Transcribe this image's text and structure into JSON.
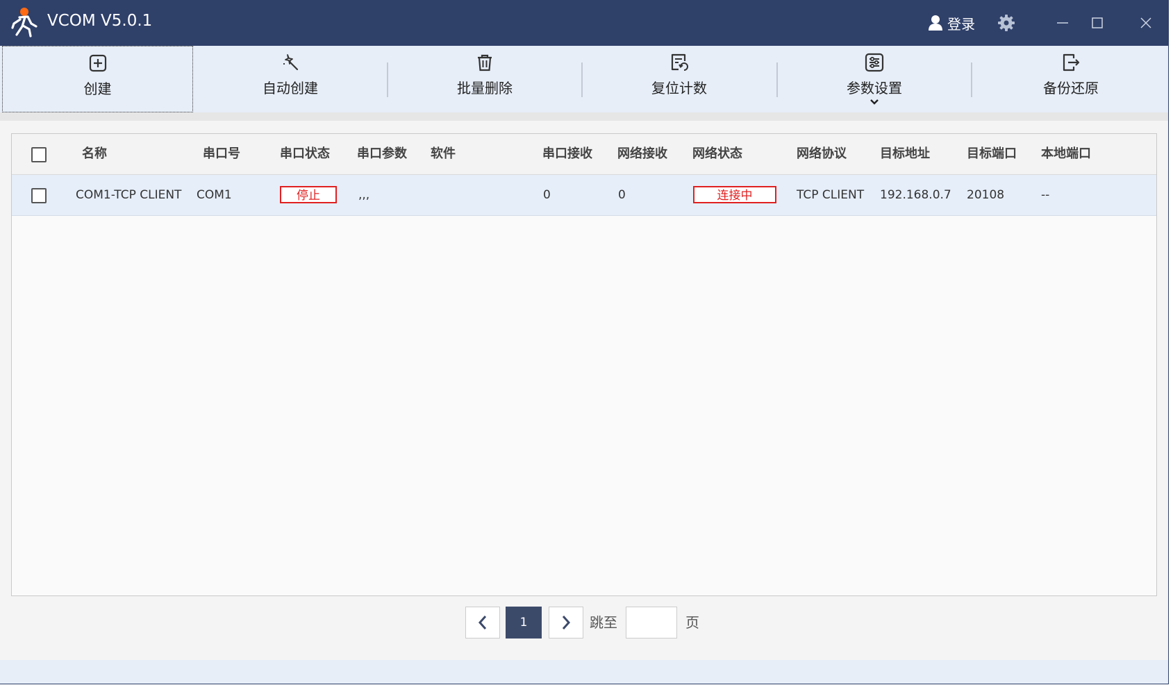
{
  "window": {
    "title": "VCOM V5.0.1"
  },
  "titlebar": {
    "login_label": "登录"
  },
  "toolbar": [
    {
      "label": "创建",
      "icon": "plus-square-icon"
    },
    {
      "label": "自动创建",
      "icon": "magic-wand-icon"
    },
    {
      "label": "批量删除",
      "icon": "trash-icon"
    },
    {
      "label": "复位计数",
      "icon": "reset-counter-icon"
    },
    {
      "label": "参数设置",
      "icon": "sliders-icon"
    },
    {
      "label": "备份还原",
      "icon": "backup-restore-icon"
    }
  ],
  "table": {
    "columns": [
      "名称",
      "串口号",
      "串口状态",
      "串口参数",
      "软件",
      "串口接收",
      "网络接收",
      "网络状态",
      "网络协议",
      "目标地址",
      "目标端口",
      "本地端口"
    ],
    "rows": [
      {
        "name": "COM1-TCP CLIENT",
        "port": "COM1",
        "port_status": "停止",
        "port_params": ",,,",
        "software": "",
        "port_rx": "0",
        "net_rx": "0",
        "net_status": "连接中",
        "protocol": "TCP CLIENT",
        "target_addr": "192.168.0.7",
        "target_port": "20108",
        "local_port": "--"
      }
    ]
  },
  "pagination": {
    "current_page": "1",
    "jump_to_label": "跳至",
    "page_suffix": "页",
    "jump_value": ""
  },
  "colors": {
    "titlebar": "#2f4069",
    "toolbar": "#e7eef8",
    "row_highlight": "#e6eef9",
    "status_red": "#e02020",
    "pager_active": "#3c4a6a"
  }
}
